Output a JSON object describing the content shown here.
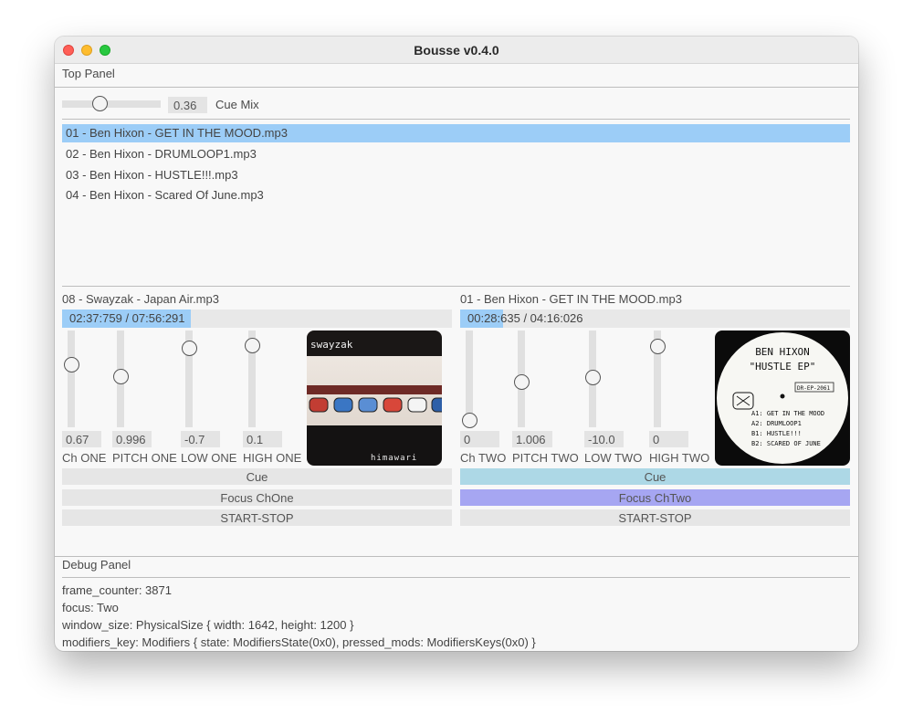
{
  "window": {
    "title": "Bousse v0.4.0"
  },
  "top_panel": {
    "label": "Top Panel",
    "cue_mix": {
      "value": "0.36",
      "label": "Cue Mix"
    }
  },
  "tracks": [
    "01 - Ben Hixon - GET IN THE MOOD.mp3",
    "02 - Ben Hixon - DRUMLOOP1.mp3",
    "03 - Ben Hixon - HUSTLE!!!.mp3",
    "04 - Ben Hixon - Scared Of June.mp3"
  ],
  "deck_one": {
    "track": "08 - Swayzak - Japan Air.mp3",
    "time": "02:37:759 / 07:56:291",
    "progress": 0.33,
    "sliders": [
      {
        "label": "Ch ONE",
        "value": "0.67"
      },
      {
        "label": "PITCH ONE",
        "value": "0.996"
      },
      {
        "label": "LOW ONE",
        "value": "-0.7"
      },
      {
        "label": "HIGH ONE",
        "value": "0.1"
      }
    ],
    "cover": {
      "artist": "swayzak",
      "title": "himawari"
    },
    "cue_label": "Cue",
    "focus_label": "Focus ChOne",
    "startstop_label": "START-STOP"
  },
  "deck_two": {
    "track": "01 - Ben Hixon - GET IN THE MOOD.mp3",
    "time": "00:28:635 / 04:16:026",
    "progress": 0.11,
    "sliders": [
      {
        "label": "Ch TWO",
        "value": "0"
      },
      {
        "label": "PITCH TWO",
        "value": "1.006"
      },
      {
        "label": "LOW TWO",
        "value": "-10.0"
      },
      {
        "label": "HIGH TWO",
        "value": "0"
      }
    ],
    "cover": {
      "artist": "BEN HIXON",
      "title": "\"HUSTLE EP\"",
      "catalog": "DR-EP-2061",
      "tracks": [
        "A1: GET IN THE MOOD",
        "A2: DRUMLOOP1",
        "B1: HUSTLE!!!",
        "B2: SCARED OF JUNE"
      ]
    },
    "cue_label": "Cue",
    "focus_label": "Focus ChTwo",
    "startstop_label": "START-STOP"
  },
  "debug_panel": {
    "label": "Debug Panel",
    "lines": [
      "frame_counter: 3871",
      "focus: Two",
      "window_size: PhysicalSize { width: 1642, height: 1200 }",
      "modifiers_key: Modifiers { state: ModifiersState(0x0), pressed_mods: ModifiersKeys(0x0) }"
    ]
  },
  "colors": {
    "selection": "#9ccdf7",
    "cue_active": "#add8e6",
    "focus_active": "#a6a6f2"
  }
}
